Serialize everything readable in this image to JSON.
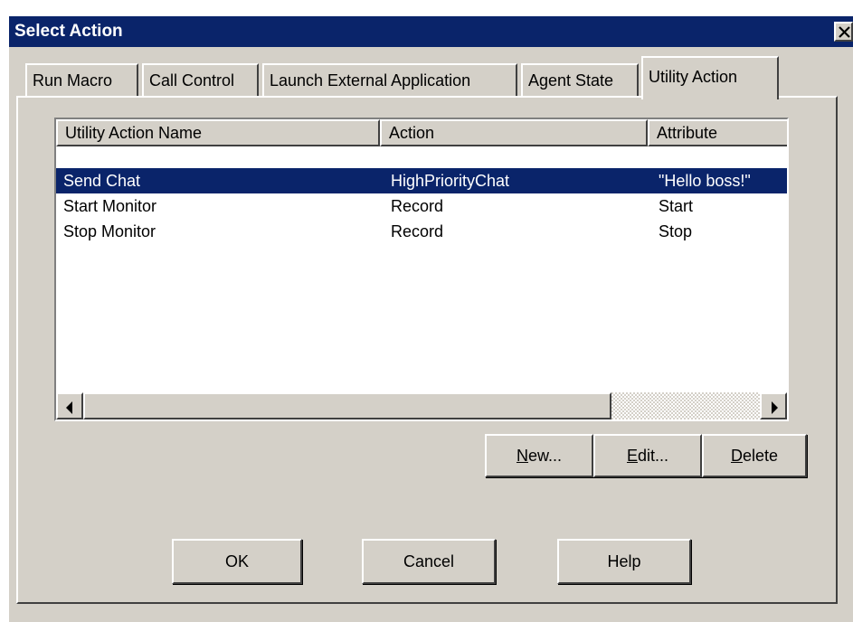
{
  "window": {
    "title": "Select Action",
    "close_glyph": "✕"
  },
  "tabs": [
    {
      "label": "Run Macro",
      "active": false
    },
    {
      "label": "Call Control",
      "active": false
    },
    {
      "label": "Launch External Application",
      "active": false
    },
    {
      "label": "Agent State",
      "active": false
    },
    {
      "label": "Utility Action",
      "active": true
    }
  ],
  "list": {
    "columns": [
      "Utility Action Name",
      "Action",
      "Attribute"
    ],
    "rows": [
      {
        "name": "Send Chat",
        "action": "HighPriorityChat",
        "attribute": "\"Hello boss!\"",
        "selected": true
      },
      {
        "name": "Start Monitor",
        "action": "Record",
        "attribute": "Start",
        "selected": false
      },
      {
        "name": "Stop Monitor",
        "action": "Record",
        "attribute": "Stop",
        "selected": false
      }
    ]
  },
  "list_buttons": {
    "new": {
      "mnemonic": "N",
      "rest": "ew..."
    },
    "edit": {
      "mnemonic": "E",
      "rest": "dit..."
    },
    "delete": {
      "mnemonic": "D",
      "rest": "elete"
    }
  },
  "dialog_buttons": {
    "ok": "OK",
    "cancel": "Cancel",
    "help": "Help"
  },
  "colors": {
    "titlebar": "#0a246a",
    "face": "#d4d0c8",
    "selection": "#0a246a"
  },
  "icons": [
    "close-icon",
    "scroll-left-arrow-icon",
    "scroll-right-arrow-icon"
  ]
}
